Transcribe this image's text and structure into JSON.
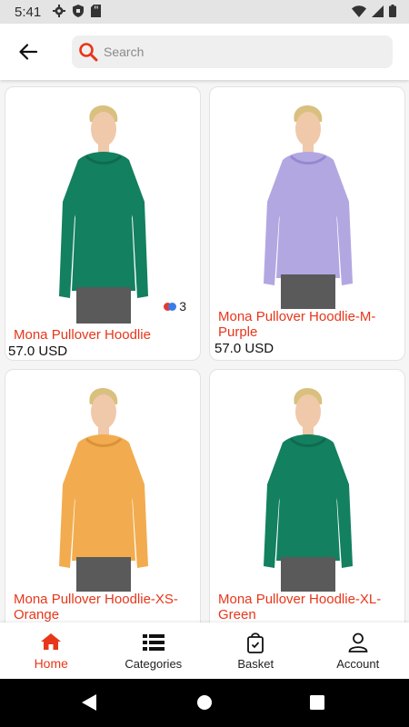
{
  "status_bar": {
    "time": "5:41"
  },
  "search": {
    "placeholder": "Search"
  },
  "products": [
    {
      "name": "Mona Pullover Hoodlie",
      "price": "57.0 USD",
      "color": "#13805f",
      "color_count": "3"
    },
    {
      "name": "Mona Pullover Hoodlie-M-Purple",
      "price": "57.0 USD",
      "color": "#b3a7e2"
    },
    {
      "name": "Mona Pullover Hoodlie-XS-Orange",
      "color": "#f2ac4f"
    },
    {
      "name": "Mona Pullover Hoodlie-XL-Green",
      "color": "#13805f"
    }
  ],
  "bottom_nav": [
    {
      "label": "Home",
      "icon": "home-icon",
      "active": true
    },
    {
      "label": "Categories",
      "icon": "list-icon"
    },
    {
      "label": "Basket",
      "icon": "basket-icon"
    },
    {
      "label": "Account",
      "icon": "account-icon"
    }
  ],
  "colors": {
    "accent": "#e8361a"
  }
}
